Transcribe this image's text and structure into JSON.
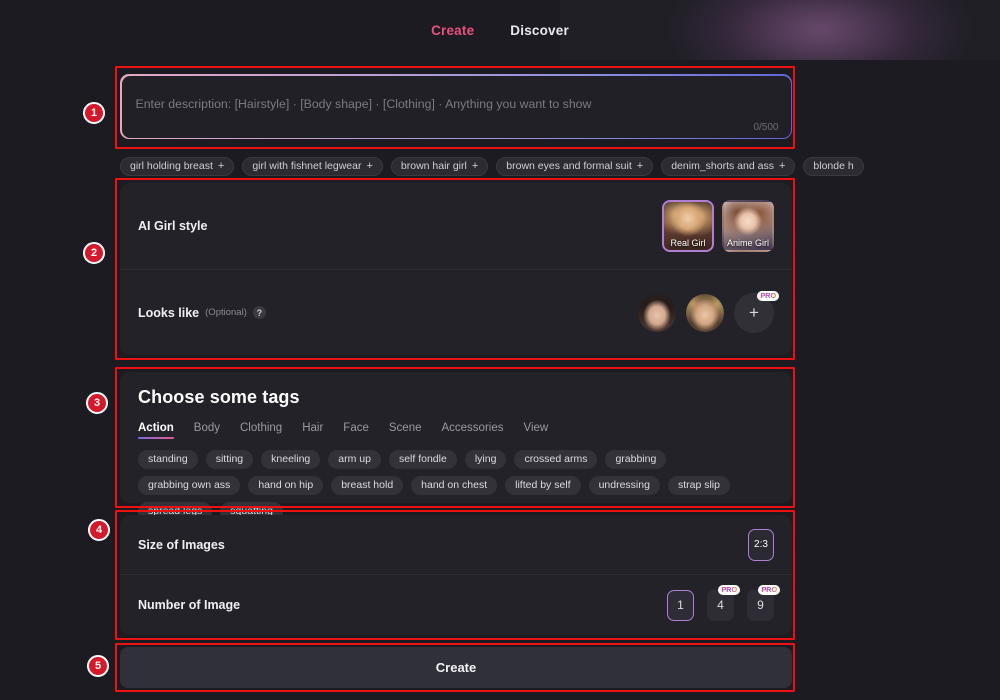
{
  "header": {
    "nav_items": [
      {
        "label": "Create",
        "active": true
      },
      {
        "label": "Discover",
        "active": false
      }
    ]
  },
  "prompt": {
    "placeholder": "Enter description: [Hairstyle] · [Body shape] · [Clothing] · Anything you want to show",
    "value": "",
    "counter": "0/500"
  },
  "suggestions": [
    {
      "label": "girl holding breast",
      "action": "+"
    },
    {
      "label": "girl with fishnet legwear",
      "action": "+"
    },
    {
      "label": "brown hair girl",
      "action": "+"
    },
    {
      "label": "brown eyes and formal suit",
      "action": "+"
    },
    {
      "label": "denim_shorts and ass",
      "action": "+"
    },
    {
      "label": "blonde h",
      "action": ""
    }
  ],
  "style_section": {
    "title": "AI Girl style",
    "options": [
      {
        "label": "Real Girl",
        "selected": true
      },
      {
        "label": "Anime Girl",
        "selected": false
      }
    ],
    "looks_like": {
      "title": "Looks like",
      "optional_note": "(Optional)",
      "help_icon": "question-mark-icon",
      "avatars": [
        "avatar-asian-woman",
        "avatar-blonde-woman"
      ],
      "add_label": "+",
      "add_badge": "PRO"
    }
  },
  "tags_section": {
    "title": "Choose some tags",
    "tabs": [
      {
        "label": "Action",
        "active": true
      },
      {
        "label": "Body",
        "active": false
      },
      {
        "label": "Clothing",
        "active": false
      },
      {
        "label": "Hair",
        "active": false
      },
      {
        "label": "Face",
        "active": false
      },
      {
        "label": "Scene",
        "active": false
      },
      {
        "label": "Accessories",
        "active": false
      },
      {
        "label": "View",
        "active": false
      }
    ],
    "tags": [
      "standing",
      "sitting",
      "kneeling",
      "arm up",
      "self fondle",
      "lying",
      "crossed arms",
      "grabbing",
      "grabbing own ass",
      "hand on hip",
      "breast hold",
      "hand on chest",
      "lifted by self",
      "undressing",
      "strap slip",
      "spread legs",
      "squatting"
    ]
  },
  "size_section": {
    "size_label": "Size of Images",
    "size_options": [
      {
        "label": "2:3",
        "selected": true
      }
    ],
    "number_label": "Number of Image",
    "number_options": [
      {
        "label": "1",
        "selected": true,
        "badge": ""
      },
      {
        "label": "4",
        "selected": false,
        "badge": "PRO"
      },
      {
        "label": "9",
        "selected": false,
        "badge": "PRO"
      }
    ]
  },
  "create_button": {
    "label": "Create"
  },
  "annotations": [
    {
      "number": "1"
    },
    {
      "number": "2"
    },
    {
      "number": "3"
    },
    {
      "number": "4"
    },
    {
      "number": "5"
    }
  ],
  "colors": {
    "accent_pink": "#e8517f",
    "selected_border": "#b07fd4",
    "annotation_red": "#ee1111",
    "background": "#1b1b21",
    "panel": "#232228"
  }
}
